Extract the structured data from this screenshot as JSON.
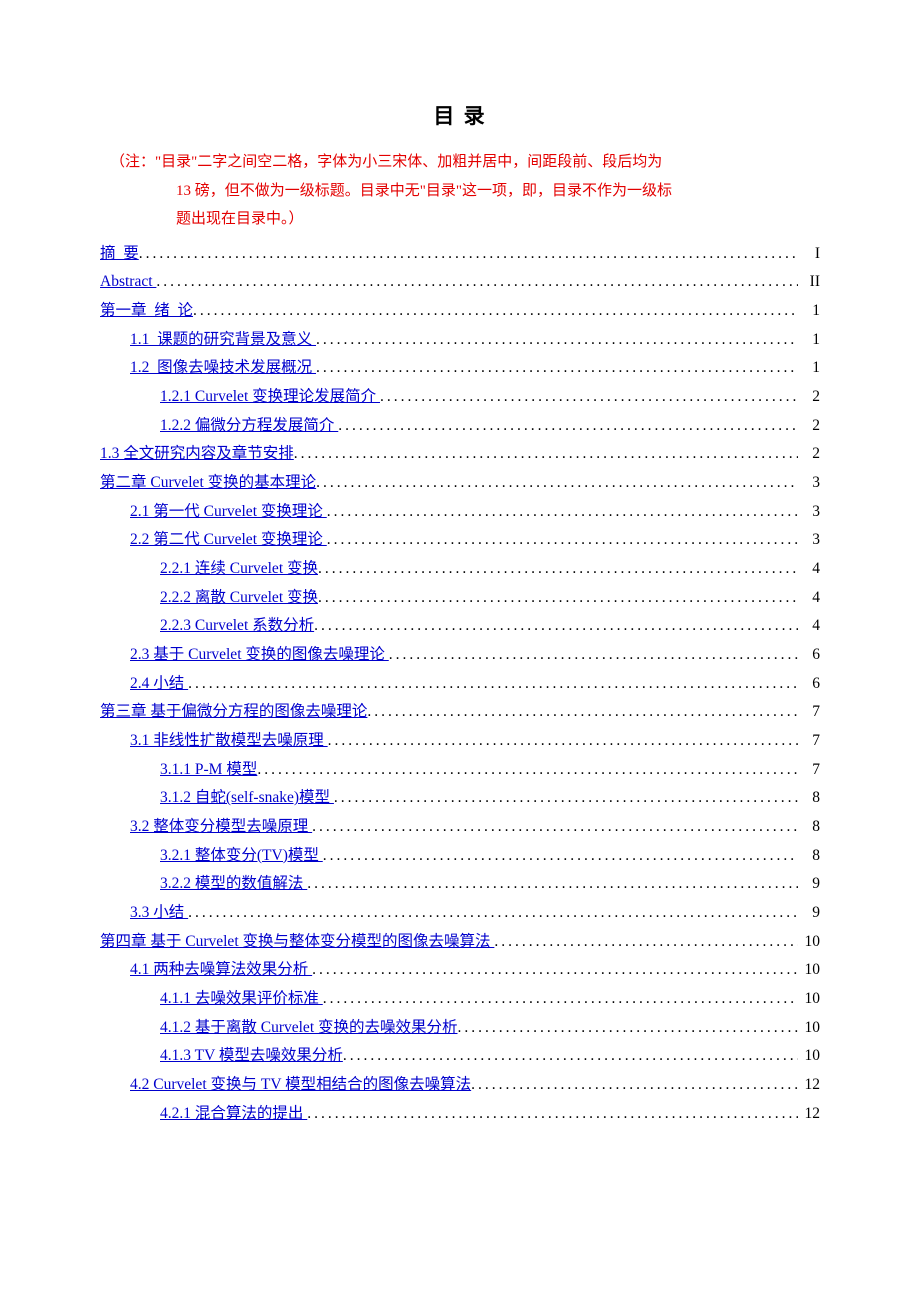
{
  "title": "目  录",
  "note": {
    "line1": "（注：\"目录\"二字之间空二格，字体为小三宋体、加粗并居中，间距段前、段后均为",
    "line2": "13 磅，但不做为一级标题。目录中无\"目录\"这一项，即，目录不作为一级标",
    "line3": "题出现在目录中。）"
  },
  "entries": [
    {
      "text": "摘  要",
      "page": "I",
      "level": 0
    },
    {
      "text": "Abstract ",
      "page": "II",
      "level": 0
    },
    {
      "text": "第一章  绪  论",
      "page": "1",
      "level": 0
    },
    {
      "text": "1.1  课题的研究背景及意义 ",
      "page": "1",
      "level": 1
    },
    {
      "text": "1.2  图像去噪技术发展概况 ",
      "page": "1",
      "level": 1
    },
    {
      "text": "1.2.1 Curvelet 变换理论发展简介 ",
      "page": "2",
      "level": 2
    },
    {
      "text": "1.2.2 偏微分方程发展简介 ",
      "page": "2",
      "level": 2
    },
    {
      "text": "1.3 全文研究内容及章节安排",
      "page": "2",
      "level": "special"
    },
    {
      "text": "第二章 Curvelet 变换的基本理论",
      "page": "3",
      "level": 0
    },
    {
      "text": "2.1 第一代 Curvelet 变换理论 ",
      "page": "3",
      "level": 1
    },
    {
      "text": "2.2 第二代 Curvelet 变换理论 ",
      "page": "3",
      "level": 1
    },
    {
      "text": "2.2.1 连续 Curvelet 变换",
      "page": "4",
      "level": 2
    },
    {
      "text": "2.2.2 离散 Curvelet 变换",
      "page": "4",
      "level": 2
    },
    {
      "text": "2.2.3 Curvelet 系数分析",
      "page": "4",
      "level": 2
    },
    {
      "text": "2.3 基于 Curvelet 变换的图像去噪理论 ",
      "page": "6",
      "level": 1
    },
    {
      "text": "2.4 小结 ",
      "page": "6",
      "level": 1
    },
    {
      "text": "第三章 基于偏微分方程的图像去噪理论",
      "page": "7",
      "level": 0
    },
    {
      "text": "3.1 非线性扩散模型去噪原理 ",
      "page": "7",
      "level": 1
    },
    {
      "text": "3.1.1 P-M 模型",
      "page": "7",
      "level": 2
    },
    {
      "text": "3.1.2 自蛇(self-snake)模型 ",
      "page": "8",
      "level": 2
    },
    {
      "text": "3.2 整体变分模型去噪原理 ",
      "page": "8",
      "level": 1
    },
    {
      "text": "3.2.1 整体变分(TV)模型 ",
      "page": "8",
      "level": 2
    },
    {
      "text": "3.2.2 模型的数值解法 ",
      "page": "9",
      "level": 2
    },
    {
      "text": "3.3 小结 ",
      "page": "9",
      "level": 1
    },
    {
      "text": "第四章 基于 Curvelet 变换与整体变分模型的图像去噪算法 ",
      "page": "10",
      "level": 0
    },
    {
      "text": "4.1 两种去噪算法效果分析 ",
      "page": "10",
      "level": 1
    },
    {
      "text": "4.1.1 去噪效果评价标准 ",
      "page": "10",
      "level": 2
    },
    {
      "text": "4.1.2 基于离散 Curvelet 变换的去噪效果分析",
      "page": "10",
      "level": 2
    },
    {
      "text": "4.1.3 TV 模型去噪效果分析",
      "page": "10",
      "level": 2
    },
    {
      "text": "4.2 Curvelet 变换与 TV 模型相结合的图像去噪算法",
      "page": "12",
      "level": 1
    },
    {
      "text": "4.2.1 混合算法的提出 ",
      "page": "12",
      "level": 2
    }
  ]
}
